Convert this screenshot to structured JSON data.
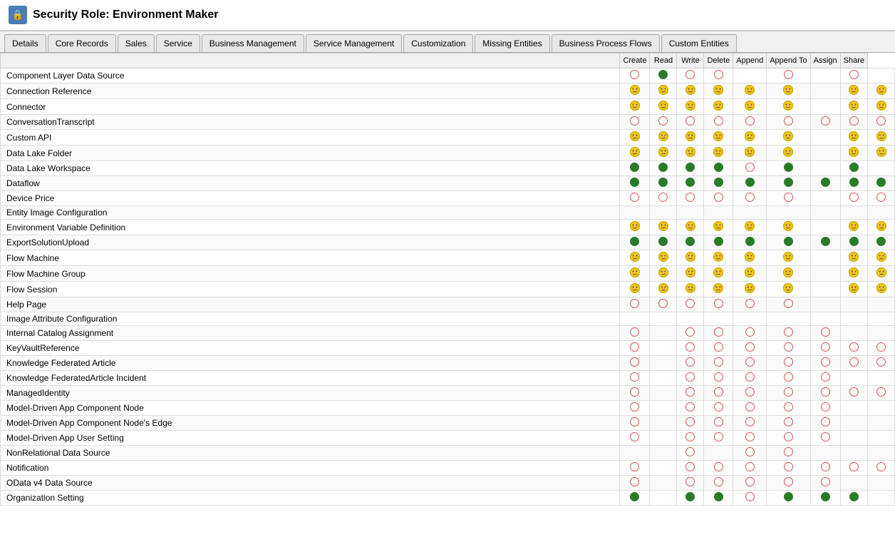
{
  "title": "Security Role: Environment Maker",
  "title_icon": "🔒",
  "tabs": [
    {
      "label": "Details",
      "active": false
    },
    {
      "label": "Core Records",
      "active": false
    },
    {
      "label": "Sales",
      "active": false
    },
    {
      "label": "Service",
      "active": false
    },
    {
      "label": "Business Management",
      "active": false
    },
    {
      "label": "Service Management",
      "active": false
    },
    {
      "label": "Customization",
      "active": false
    },
    {
      "label": "Missing Entities",
      "active": false
    },
    {
      "label": "Business Process Flows",
      "active": false
    },
    {
      "label": "Custom Entities",
      "active": false
    }
  ],
  "columns": [
    "",
    "Create",
    "Read",
    "Write",
    "Delete",
    "Append",
    "Append To",
    "Assign",
    "Share"
  ],
  "column_groups": [
    "Business Process Flows",
    "Custom Entities"
  ],
  "rows": [
    {
      "name": "Component Layer Data Source",
      "perms": [
        "empty_red",
        "full_green",
        "empty_red",
        "empty_red",
        "",
        "empty_red",
        "",
        "empty_red",
        ""
      ]
    },
    {
      "name": "Connection Reference",
      "perms": [
        "smiley",
        "smiley",
        "smiley",
        "smiley",
        "smiley",
        "smiley",
        "",
        "smiley",
        "smiley"
      ]
    },
    {
      "name": "Connector",
      "perms": [
        "smiley",
        "smiley",
        "smiley",
        "smiley",
        "smiley",
        "smiley",
        "",
        "smiley",
        "smiley"
      ]
    },
    {
      "name": "ConversationTranscript",
      "perms": [
        "empty_red",
        "empty_red",
        "empty_red",
        "empty_red",
        "empty_red",
        "empty_red",
        "empty_red",
        "empty_red",
        "empty_red"
      ]
    },
    {
      "name": "Custom API",
      "perms": [
        "smiley",
        "smiley",
        "smiley",
        "smiley",
        "smiley",
        "smiley",
        "",
        "smiley",
        "smiley"
      ]
    },
    {
      "name": "Data Lake Folder",
      "perms": [
        "smiley",
        "smiley",
        "smiley",
        "smiley",
        "smiley",
        "smiley",
        "",
        "smiley",
        "smiley"
      ]
    },
    {
      "name": "Data Lake Workspace",
      "perms": [
        "full_green",
        "full_green",
        "full_green",
        "full_green",
        "empty_red",
        "full_green",
        "",
        "full_green",
        ""
      ]
    },
    {
      "name": "Dataflow",
      "perms": [
        "full_green",
        "full_green",
        "full_green",
        "full_green",
        "full_green",
        "full_green",
        "full_green",
        "full_green",
        "full_green"
      ]
    },
    {
      "name": "Device Price",
      "perms": [
        "empty_red",
        "empty_red",
        "empty_red",
        "empty_red",
        "empty_red",
        "empty_red",
        "",
        "empty_red",
        "empty_red"
      ]
    },
    {
      "name": "Entity Image Configuration",
      "perms": [
        "",
        "",
        "",
        "",
        "",
        "",
        "",
        "",
        ""
      ]
    },
    {
      "name": "Environment Variable Definition",
      "perms": [
        "smiley",
        "smiley",
        "smiley",
        "smiley",
        "smiley",
        "smiley",
        "",
        "smiley",
        "smiley"
      ]
    },
    {
      "name": "ExportSolutionUpload",
      "perms": [
        "full_green",
        "full_green",
        "full_green",
        "full_green",
        "full_green",
        "full_green",
        "full_green",
        "full_green",
        "full_green"
      ]
    },
    {
      "name": "Flow Machine",
      "perms": [
        "smiley",
        "smiley",
        "smiley",
        "smiley",
        "smiley",
        "smiley",
        "",
        "smiley",
        "smiley"
      ]
    },
    {
      "name": "Flow Machine Group",
      "perms": [
        "smiley",
        "smiley",
        "smiley",
        "smiley",
        "smiley",
        "smiley",
        "",
        "smiley",
        "smiley"
      ]
    },
    {
      "name": "Flow Session",
      "perms": [
        "smiley",
        "smiley",
        "smiley",
        "smiley",
        "smiley",
        "smiley",
        "",
        "smiley",
        "smiley"
      ]
    },
    {
      "name": "Help Page",
      "perms": [
        "empty_red",
        "empty_red",
        "empty_red",
        "empty_red",
        "empty_red",
        "empty_red",
        "",
        "",
        ""
      ]
    },
    {
      "name": "Image Attribute Configuration",
      "perms": [
        "",
        "",
        "",
        "",
        "",
        "",
        "",
        "",
        ""
      ]
    },
    {
      "name": "Internal Catalog Assignment",
      "perms": [
        "empty_red",
        "",
        "empty_red",
        "empty_red",
        "empty_red",
        "empty_red",
        "empty_red",
        "",
        ""
      ]
    },
    {
      "name": "KeyVaultReference",
      "perms": [
        "empty_red",
        "",
        "empty_red",
        "empty_red",
        "empty_red",
        "empty_red",
        "empty_red",
        "empty_red",
        "empty_red"
      ]
    },
    {
      "name": "Knowledge Federated Article",
      "perms": [
        "empty_red",
        "",
        "empty_red",
        "empty_red",
        "empty_red",
        "empty_red",
        "empty_red",
        "empty_red",
        "empty_red"
      ]
    },
    {
      "name": "Knowledge FederatedArticle Incident",
      "perms": [
        "empty_red",
        "",
        "empty_red",
        "empty_red",
        "empty_red",
        "empty_red",
        "empty_red",
        "",
        ""
      ]
    },
    {
      "name": "ManagedIdentity",
      "perms": [
        "empty_red",
        "",
        "empty_red",
        "empty_red",
        "empty_red",
        "empty_red",
        "empty_red",
        "empty_red",
        "empty_red"
      ]
    },
    {
      "name": "Model-Driven App Component Node",
      "perms": [
        "empty_red",
        "",
        "empty_red",
        "empty_red",
        "empty_red",
        "empty_red",
        "empty_red",
        "",
        ""
      ]
    },
    {
      "name": "Model-Driven App Component Node's Edge",
      "perms": [
        "empty_red",
        "",
        "empty_red",
        "empty_red",
        "empty_red",
        "empty_red",
        "empty_red",
        "",
        ""
      ]
    },
    {
      "name": "Model-Driven App User Setting",
      "perms": [
        "empty_red",
        "",
        "empty_red",
        "empty_red",
        "empty_red",
        "empty_red",
        "empty_red",
        "",
        ""
      ]
    },
    {
      "name": "NonRelational Data Source",
      "perms": [
        "",
        "",
        "empty_red",
        "",
        "empty_red",
        "empty_red",
        "",
        "",
        ""
      ]
    },
    {
      "name": "Notification",
      "perms": [
        "empty_red",
        "",
        "empty_red",
        "empty_red",
        "empty_red",
        "empty_red",
        "empty_red",
        "empty_red",
        "empty_red"
      ]
    },
    {
      "name": "OData v4 Data Source",
      "perms": [
        "empty_red",
        "",
        "empty_red",
        "empty_red",
        "empty_red",
        "empty_red",
        "empty_red",
        "",
        ""
      ]
    },
    {
      "name": "Organization Setting",
      "perms": [
        "full_green",
        "",
        "full_green",
        "full_green",
        "empty_red",
        "full_green",
        "full_green",
        "full_green",
        ""
      ]
    }
  ]
}
